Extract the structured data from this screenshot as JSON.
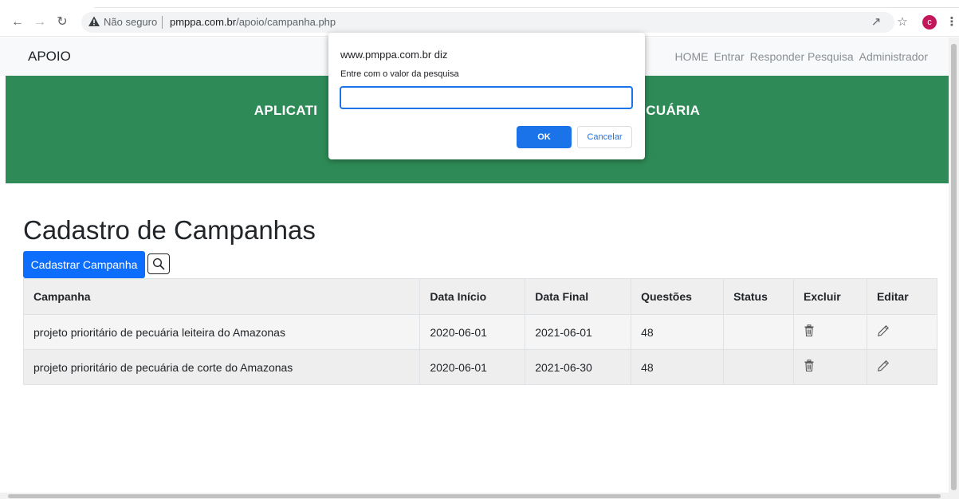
{
  "browser": {
    "security_label": "Não seguro",
    "url_domain": "pmppa.com.br",
    "url_path": "/apoio/campanha.php",
    "profile_initial": "c"
  },
  "navbar": {
    "brand": "APOIO",
    "links": [
      "HOME",
      "Entrar",
      "Responder Pesquisa",
      "Administrador"
    ]
  },
  "hero": {
    "title_left": "APLICATI",
    "title_right": "CUÁRIA"
  },
  "main": {
    "title": "Cadastro de Campanhas",
    "add_button": "Cadastrar Campanha",
    "table": {
      "headers": [
        "Campanha",
        "Data Início",
        "Data Final",
        "Questões",
        "Status",
        "Excluir",
        "Editar"
      ],
      "rows": [
        [
          "projeto prioritário de pecuária leiteira do Amazonas",
          "2020-06-01",
          "2021-06-01",
          "48",
          ""
        ],
        [
          "projeto prioritário de pecuária de corte do Amazonas",
          "2020-06-01",
          "2021-06-30",
          "48",
          ""
        ]
      ]
    }
  },
  "dialog": {
    "origin": "www.pmppa.com.br diz",
    "message": "Entre com o valor da pesquisa",
    "input_value": "",
    "ok_label": "OK",
    "cancel_label": "Cancelar"
  },
  "colors": {
    "hero_bg": "#2e8b57",
    "primary": "#0d6efd",
    "dialog_accent": "#1a73e8"
  }
}
